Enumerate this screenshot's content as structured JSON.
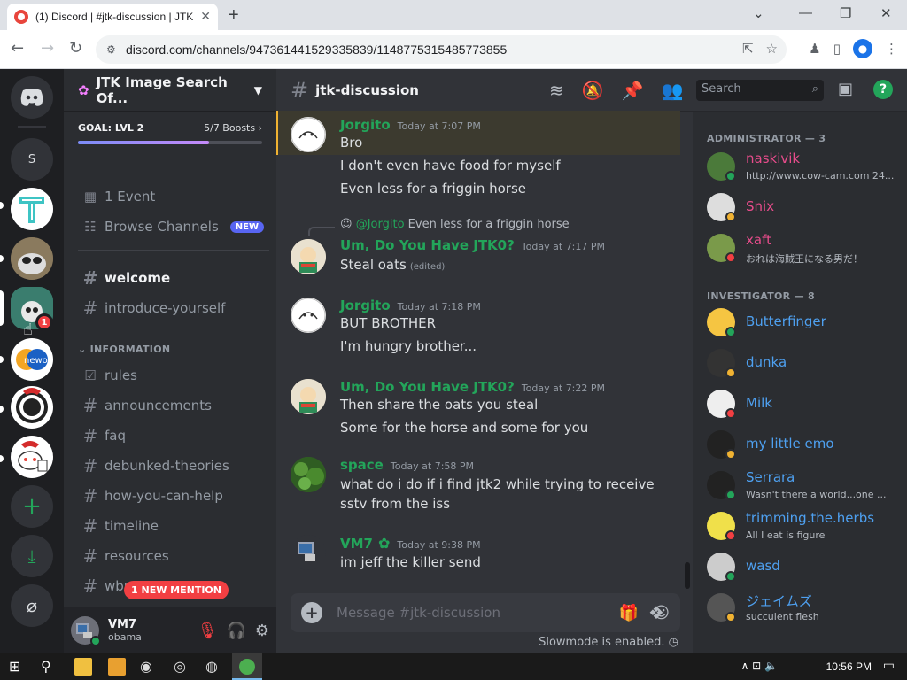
{
  "browser": {
    "tab_title": "(1) Discord | #jtk-discussion | JTK",
    "url": "discord.com/channels/947361441529335839/1148775315485773855",
    "new_tab": "+",
    "win_min": "⌄",
    "win_minimize": "—",
    "win_restore": "❐",
    "win_close": "✕"
  },
  "server": {
    "name": "JTK Image Search Of...",
    "goal_label": "GOAL: LVL 2",
    "boosts": "5/7 Boosts",
    "boost_progress": 0.71
  },
  "sidebar_links": [
    {
      "label": "1 Event"
    },
    {
      "label": "Browse Channels",
      "badge": "NEW"
    }
  ],
  "channels_top": [
    {
      "label": "welcome",
      "unread": true
    },
    {
      "label": "introduce-yourself",
      "unread": false
    }
  ],
  "category": "INFORMATION",
  "channels_info": [
    {
      "label": "rules"
    },
    {
      "label": "announcements"
    },
    {
      "label": "faq"
    },
    {
      "label": "debunked-theories"
    },
    {
      "label": "how-you-can-help"
    },
    {
      "label": "timeline"
    },
    {
      "label": "resources"
    },
    {
      "label": "wbm-..."
    }
  ],
  "mention_pill": "1 NEW MENTION",
  "guild_badge": "1",
  "guild_s": "S",
  "user": {
    "name": "VM7",
    "status": "obama"
  },
  "chat": {
    "channel": "jtk-discussion",
    "placeholder": "Message #jtk-discussion",
    "slowmode": "Slowmode is enabled.",
    "messages": [
      {
        "user": "Jorgito",
        "time": "Today at 7:07 PM",
        "lines": [
          "Bro",
          "I don't even have food for myself",
          "Even less for a friggin horse"
        ]
      },
      {
        "reply_user": "@Jorgito",
        "reply_text": "Even less for a friggin horse",
        "user": "Um, Do You Have JTK0?",
        "time": "Today at 7:17 PM",
        "lines": [
          "Steal oats"
        ],
        "edited": "(edited)"
      },
      {
        "user": "Jorgito",
        "time": "Today at 7:18 PM",
        "lines": [
          "BUT BROTHER",
          "I'm hungry brother..."
        ]
      },
      {
        "user": "Um, Do You Have JTK0?",
        "time": "Today at 7:22 PM",
        "lines": [
          "Then share the oats you steal",
          "Some for the horse and some for you"
        ]
      },
      {
        "user": "space",
        "time": "Today at 7:58 PM",
        "lines": [
          "what do  i do if i find jtk2 while trying to receive",
          "sstv from the iss"
        ]
      },
      {
        "user": "VM7",
        "time": "Today at 9:38 PM",
        "lines": [
          "im jeff the killer send"
        ]
      }
    ]
  },
  "search_placeholder": "Search",
  "members": {
    "admin_header": "ADMINISTRATOR — 3",
    "admins": [
      {
        "name": "naskivik",
        "sub": "http://www.cow-cam.com 24...",
        "color": "#e74c8b"
      },
      {
        "name": "Snix",
        "sub": "",
        "color": "#e74c8b"
      },
      {
        "name": "xaft",
        "sub": "おれは海賊王になる男だ！",
        "color": "#e74c8b"
      }
    ],
    "inv_header": "INVESTIGATOR — 8",
    "investigators": [
      {
        "name": "Butterfinger",
        "sub": ""
      },
      {
        "name": "dunka",
        "sub": ""
      },
      {
        "name": "Milk",
        "sub": ""
      },
      {
        "name": "my little emo",
        "sub": ""
      },
      {
        "name": "Serrara",
        "sub": "Wasn't there a world...one ..."
      },
      {
        "name": "trimming.the.herbs",
        "sub": "All I eat is figure"
      },
      {
        "name": "wasd",
        "sub": ""
      },
      {
        "name": "ジェイムズ",
        "sub": "succulent flesh"
      }
    ]
  },
  "taskbar": {
    "time": "10:56 PM"
  },
  "colors": {
    "admin": "#e74c8b",
    "investigator": "#4ea0f0",
    "green_user": "#23a55a",
    "jorgito": "#23a55a"
  }
}
